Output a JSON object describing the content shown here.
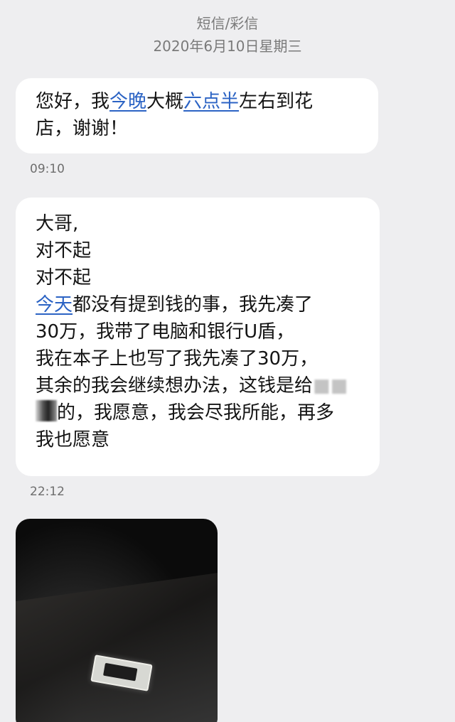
{
  "header": {
    "type": "短信/彩信",
    "date": "2020年6月10日星期三"
  },
  "messages": [
    {
      "lines": [
        [
          "您好，我",
          "今晚",
          "大概",
          "六点半",
          "左右到花"
        ],
        [
          "店，谢谢！"
        ]
      ],
      "time": "09:10"
    },
    {
      "lines": [
        [
          "大哥,"
        ],
        [
          "对不起"
        ],
        [
          "对不起"
        ],
        [
          "今天",
          "都没有提到钱的事，我先凑了"
        ],
        [
          "30万，我带了电脑和银行U盾，"
        ],
        [
          "我在本子上也写了我先凑了30万，"
        ],
        [
          "其余的我会继续想办法，这钱是给"
        ],
        [
          "的，我愿意，我会尽我所能，再多"
        ],
        [
          "我也愿意"
        ]
      ],
      "time": "22:12"
    }
  ],
  "photo": {
    "icon": "photo-attachment"
  },
  "colors": {
    "background": "#eeeef0",
    "bubble": "#ffffff",
    "link": "#2b63c4",
    "meta_text": "#7a7a7a"
  }
}
